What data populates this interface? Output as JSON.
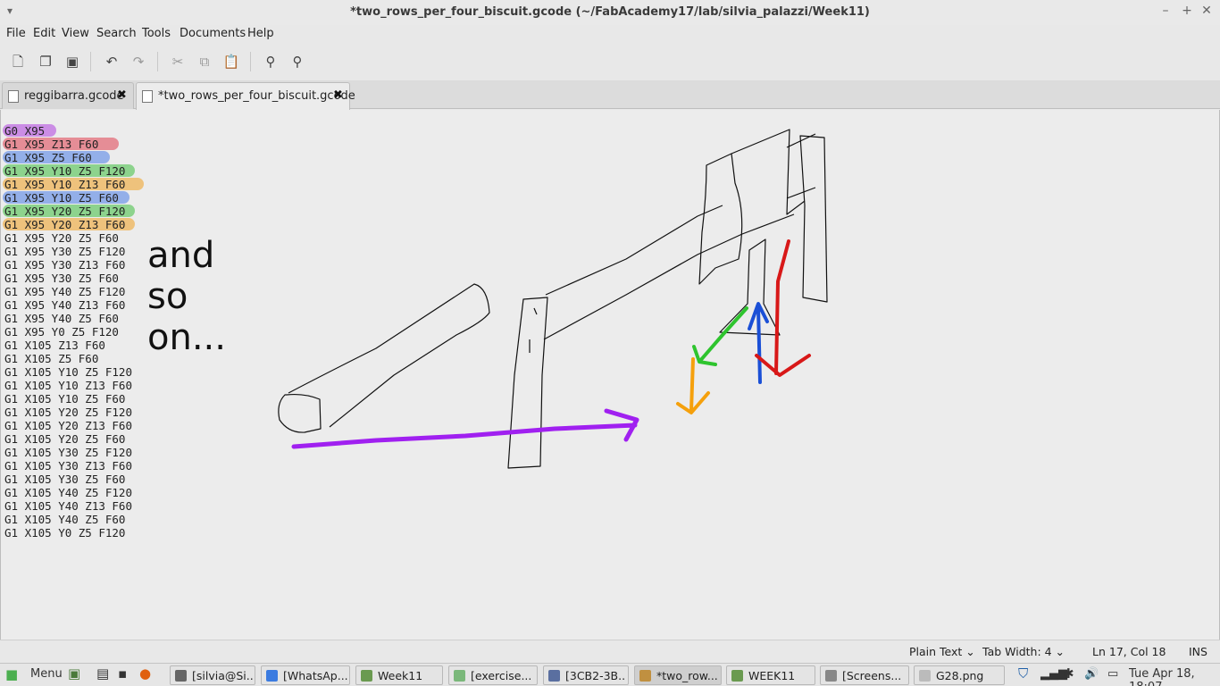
{
  "window": {
    "title": "*two_rows_per_four_biscuit.gcode (~/FabAcademy17/lab/silvia_palazzi/Week11)",
    "menu_glyph": "▾",
    "minimize": "–",
    "maximize": "+",
    "close": "✕"
  },
  "menubar": [
    "File",
    "Edit",
    "View",
    "Search",
    "Tools",
    "Documents",
    "Help"
  ],
  "toolbar": {
    "new": "new-document-icon",
    "open": "open-icon",
    "save": "save-icon",
    "undo": "undo-icon",
    "redo": "redo-icon",
    "cut": "cut-icon",
    "copy": "copy-icon",
    "paste": "paste-icon",
    "find": "find-icon",
    "find_replace": "find-replace-icon"
  },
  "tabs": [
    {
      "label": "reggibarra.gcode",
      "close": "✖"
    },
    {
      "label": "*two_rows_per_four_biscuit.gcode",
      "close": "✖"
    }
  ],
  "editor": {
    "lines": [
      "G0 X95",
      "G1 X95 Z13 F60",
      "G1 X95 Z5 F60",
      "G1 X95 Y10 Z5 F120",
      "G1 X95 Y10 Z13 F60",
      "G1 X95 Y10 Z5 F60",
      "G1 X95 Y20 Z5 F120",
      "G1 X95 Y20 Z13 F60",
      "G1 X95 Y20 Z5 F60",
      "G1 X95 Y30 Z5 F120",
      "G1 X95 Y30 Z13 F60",
      "G1 X95 Y30 Z5 F60",
      "G1 X95 Y40 Z5 F120",
      "G1 X95 Y40 Z13 F60",
      "G1 X95 Y40 Z5 F60",
      "G1 X95 Y0 Z5 F120",
      "G1 X105 Z13 F60",
      "G1 X105 Z5 F60",
      "G1 X105 Y10 Z5 F120",
      "G1 X105 Y10 Z13 F60",
      "G1 X105 Y10 Z5 F60",
      "G1 X105 Y20 Z5 F120",
      "G1 X105 Y20 Z13 F60",
      "G1 X105 Y20 Z5 F60",
      "G1 X105 Y30 Z5 F120",
      "G1 X105 Y30 Z13 F60",
      "G1 X105 Y30 Z5 F60",
      "G1 X105 Y40 Z5 F120",
      "G1 X105 Y40 Z13 F60",
      "G1 X105 Y40 Z5 F60",
      "G1 X105 Y0 Z5 F120"
    ],
    "highlight_colors": [
      "#b040e0",
      "#e04050",
      "#4a7ee8",
      "#40c040",
      "#f0a020",
      "#4a7ee8",
      "#40c040",
      "#f0a020"
    ],
    "note": [
      "and",
      "so",
      "on..."
    ]
  },
  "colors": {
    "purple": "#a020f0",
    "green": "#2ec42e",
    "blue": "#1a4fd6",
    "red": "#d81818",
    "orange": "#f5a00c"
  },
  "statusbar": {
    "language": "Plain Text ⌄",
    "tab_width": "Tab Width:  4  ⌄",
    "position": "Ln 17, Col 18",
    "mode": "INS"
  },
  "taskbar": {
    "menu": "Menu",
    "tasks": [
      "[silvia@Si...",
      "[WhatsAp...",
      "Week11",
      "[exercise...",
      "[3CB2-3B...",
      "*two_row...",
      "WEEK11",
      "[Screens...",
      "G28.png"
    ],
    "clock": "Tue Apr 18, 18:07"
  }
}
